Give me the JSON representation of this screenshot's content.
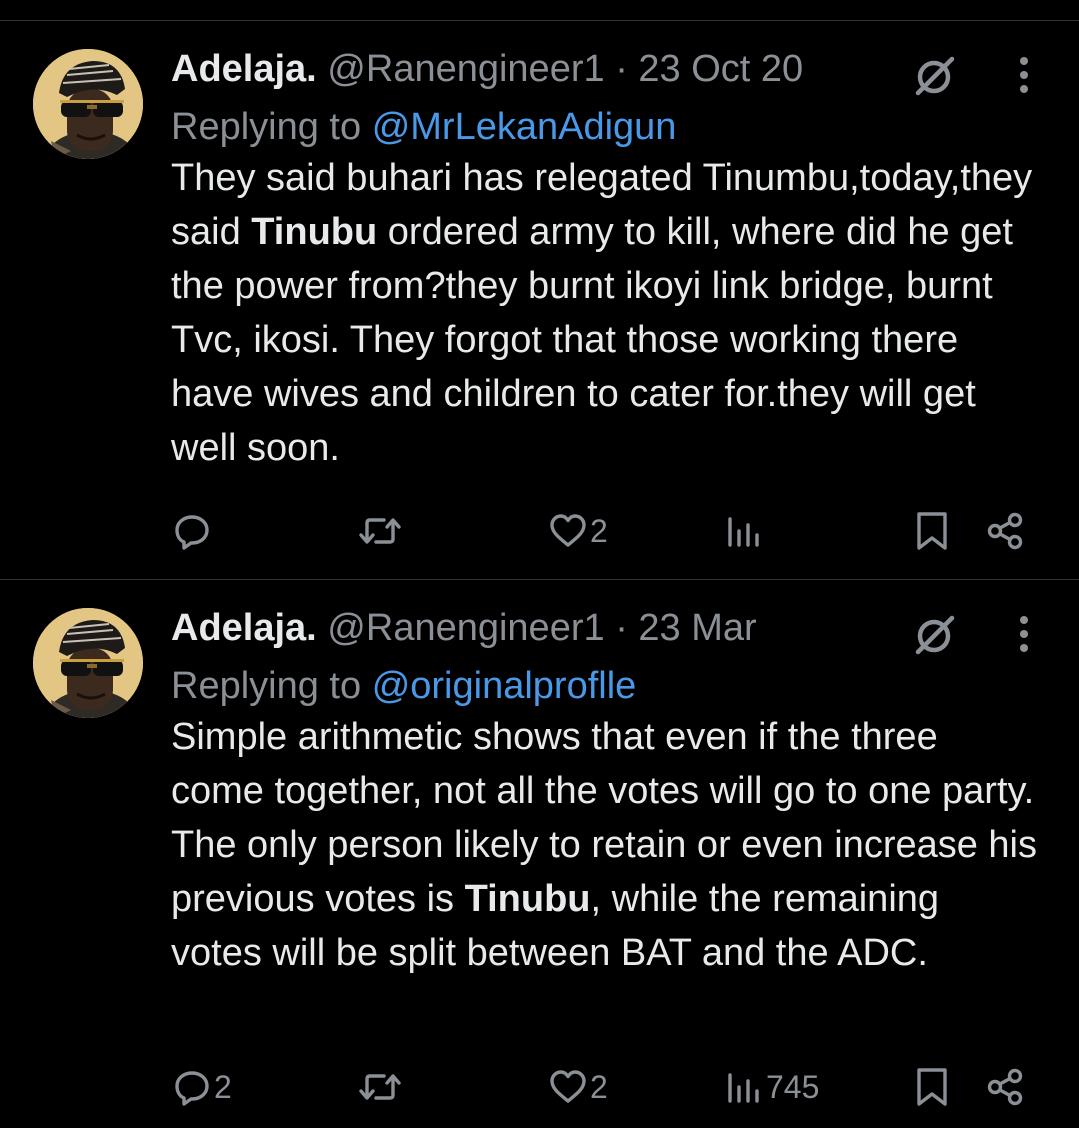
{
  "tweets": [
    {
      "author_name": "Adelaja.",
      "handle": "@Ranengineer1",
      "separator": "·",
      "date": "23 Oct 20",
      "replying_prefix": "Replying to",
      "replying_to": "@MrLekanAdigun",
      "body": {
        "before": "They said buhari has relegated Tinumbu,today,they said ",
        "bold": "Tinubu",
        "after": " ordered army to kill, where did he get the power from?they burnt ikoyi link bridge, burnt Tvc, ikosi. They forgot that those working there have wives and children to cater for.they will get well soon."
      },
      "metrics": {
        "replies": "",
        "reposts": "",
        "likes": "2",
        "views": ""
      }
    },
    {
      "author_name": "Adelaja.",
      "handle": "@Ranengineer1",
      "separator": "·",
      "date": "23 Mar",
      "replying_prefix": "Replying to",
      "replying_to": "@originalproflle",
      "body": {
        "before": "Simple arithmetic shows that even if the three come together, not all the votes will go to one party. The only person likely to retain or even increase his previous votes is ",
        "bold": "Tinubu",
        "after": ", while the remaining votes will be split between BAT and the ADC."
      },
      "metrics": {
        "replies": "2",
        "reposts": "",
        "likes": "2",
        "views": "745"
      }
    }
  ],
  "icons": [
    "avatar-image",
    "grok-icon",
    "more-icon",
    "reply-icon",
    "repost-icon",
    "like-icon",
    "views-icon",
    "bookmark-icon",
    "share-icon"
  ],
  "colors": {
    "background": "#000000",
    "text": "#e7e9ea",
    "muted": "#8b9096",
    "link": "#4a99e9",
    "divider": "#2f3336"
  }
}
